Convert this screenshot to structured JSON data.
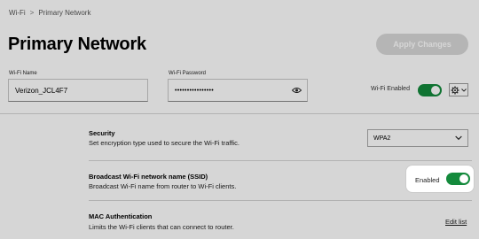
{
  "breadcrumb": {
    "root": "Wi-Fi",
    "separator": ">",
    "current": "Primary Network"
  },
  "page": {
    "title": "Primary Network"
  },
  "actions": {
    "apply_label": "Apply Changes"
  },
  "wifi_name": {
    "label": "Wi-Fi Name",
    "value": "Verizon_JCL4F7"
  },
  "wifi_password": {
    "label": "Wi-Fi Password",
    "value": "••••••••••••••••"
  },
  "wifi_enabled": {
    "label": "Wi-Fi Enabled",
    "on": true
  },
  "security": {
    "title": "Security",
    "description": "Set encryption type used to secure the Wi-Fi traffic.",
    "selected": "WPA2"
  },
  "broadcast": {
    "title": "Broadcast Wi-Fi network name (SSID)",
    "description": "Broadcast Wi-Fi name from router to Wi-Fi clients.",
    "state_label": "Enabled",
    "on": true
  },
  "mac_auth": {
    "title": "MAC Authentication",
    "description": "Limits the Wi-Fi clients that can connect to router.",
    "link_label": "Edit list"
  },
  "colors": {
    "toggle_on": "#148a3c",
    "apply_disabled": "#d8d8d8",
    "overlay": "rgba(0,0,0,0.16)"
  },
  "icons": {
    "eye": "eye-icon",
    "gear": "gear-icon",
    "chevron": "chevron-down-icon"
  }
}
